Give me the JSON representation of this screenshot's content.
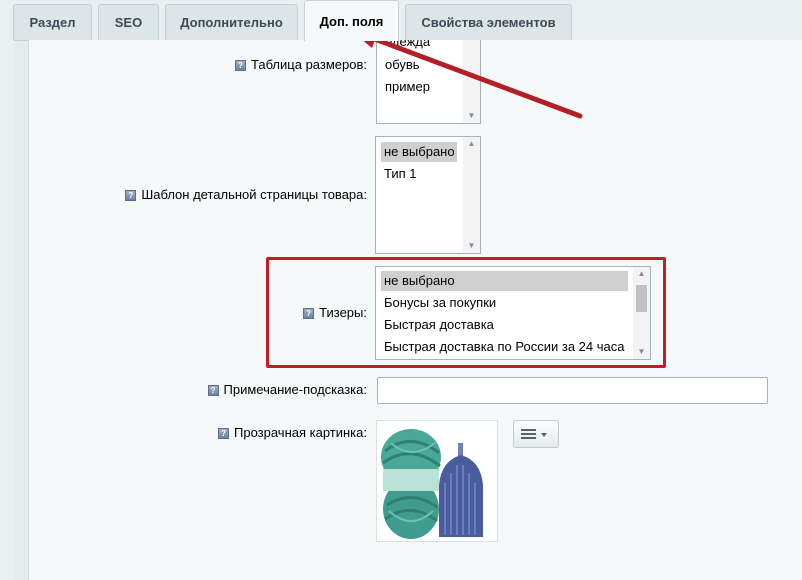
{
  "tabs": [
    {
      "label": "Раздел"
    },
    {
      "label": "SEO"
    },
    {
      "label": "Дополнительно"
    },
    {
      "label": "Доп. поля"
    },
    {
      "label": "Свойства элементов"
    }
  ],
  "fields": {
    "size_table": {
      "label": "Таблица размеров:",
      "options": [
        "одежда",
        "обувь",
        "пример"
      ]
    },
    "detail_template": {
      "label": "Шаблон детальной страницы товара:",
      "options": [
        "не выбрано",
        "Тип 1"
      ],
      "selected": "не выбрано"
    },
    "teasers": {
      "label": "Тизеры:",
      "options": [
        "не выбрано",
        "Бонусы за покупки",
        "Быстрая доставка",
        "Быстрая доставка по России за 24 часа"
      ],
      "selected": "не выбрано"
    },
    "hint_note": {
      "label": "Примечание-подсказка:",
      "value": ""
    },
    "transparent_image": {
      "label": "Прозрачная картинка:"
    }
  },
  "colors": {
    "highlight_box": "#c81b26",
    "arrow": "#b31f24",
    "yarn": "#3f9c8f",
    "vase": "#4a5c9e"
  },
  "icons": {
    "hint": "question-icon",
    "menu": "hamburger-menu-icon",
    "dropdown": "chevron-down-icon"
  }
}
